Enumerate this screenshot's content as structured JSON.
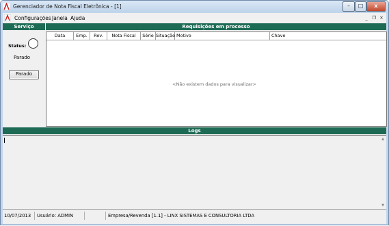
{
  "window": {
    "title": "Gerenciador de Nota Fiscal Eletrônica - [1]",
    "minimize_glyph": "–",
    "maximize_glyph": "□",
    "close_glyph": "x"
  },
  "menu": {
    "items": [
      "Configurações",
      "Janela",
      "Ajuda"
    ],
    "mdi_minimize": "_",
    "mdi_restore": "❐",
    "mdi_close": "✕"
  },
  "service_panel": {
    "header": "Serviço",
    "status_label": "Status:",
    "status_value": "Parado",
    "button_label": "Parado"
  },
  "requests_panel": {
    "header": "Requisições em processo",
    "columns": [
      "Data",
      "Emp.",
      "Rev.",
      "Nota Fiscal",
      "Série",
      "Situação",
      "Motivo",
      "Chave"
    ],
    "empty_message": "<Não existem dados para visualizar>"
  },
  "logs_panel": {
    "header": "Logs"
  },
  "statusbar": {
    "date": "10/07/2013",
    "user": "Usuário: ADMIN",
    "company": "Empresa/Revenda [1.1] - LINX SISTEMAS E CONSULTORIA LTDA"
  },
  "colors": {
    "header_green": "#1e6b55",
    "title_gradient": "#bed3ea",
    "close_red": "#c2462b"
  },
  "icons": {
    "app": "red-A-logo-icon",
    "scroll_up": "scroll-up-arrow-icon",
    "scroll_down": "scroll-down-arrow-icon"
  }
}
